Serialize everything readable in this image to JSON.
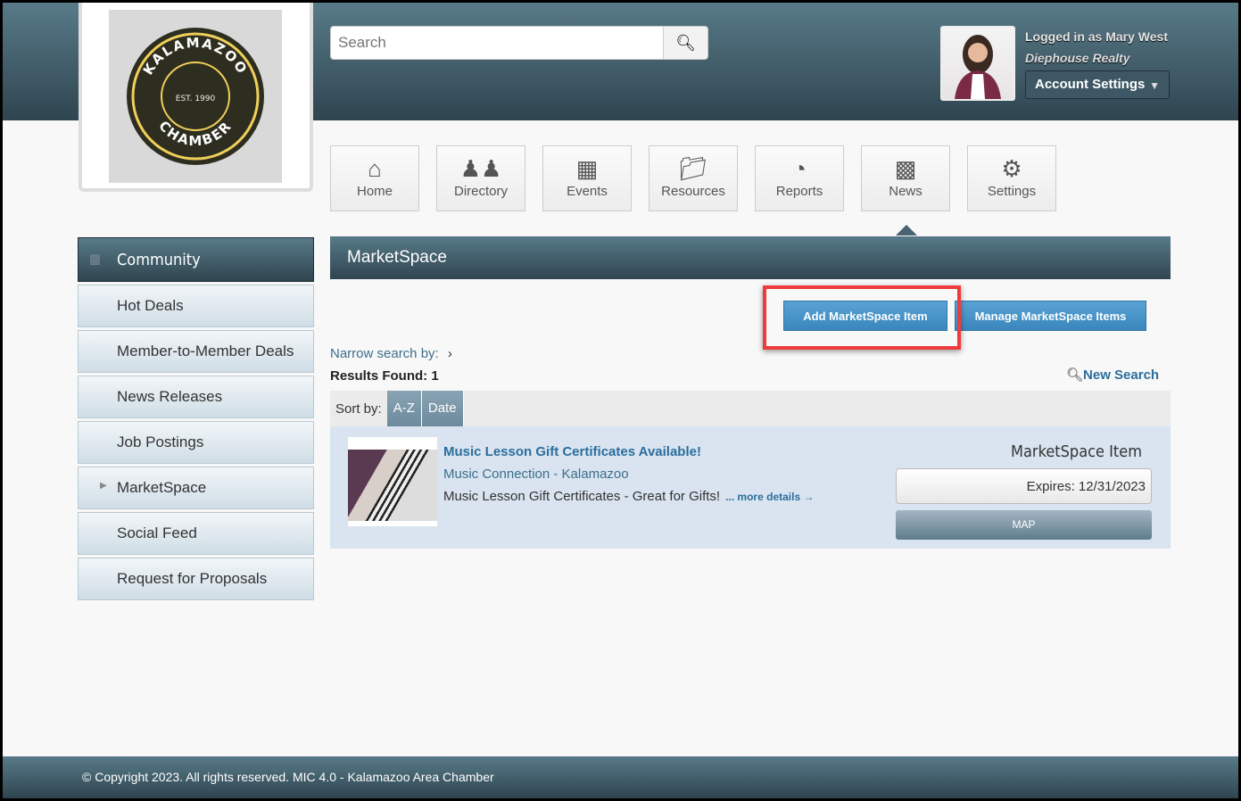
{
  "logo": {
    "text_top": "KALAMAZOO",
    "text_bottom": "CHAMBER",
    "est": "EST. 1990"
  },
  "search": {
    "placeholder": "Search",
    "icon": "search-icon"
  },
  "user": {
    "logged_in": "Logged in as Mary West",
    "company": "Diephouse Realty",
    "account_settings": "Account Settings"
  },
  "nav": [
    {
      "label": "Home",
      "icon": "home-icon"
    },
    {
      "label": "Directory",
      "icon": "people-icon"
    },
    {
      "label": "Events",
      "icon": "calendar-icon"
    },
    {
      "label": "Resources",
      "icon": "folder-icon"
    },
    {
      "label": "Reports",
      "icon": "pie-chart-icon"
    },
    {
      "label": "News",
      "icon": "buildings-icon"
    },
    {
      "label": "Settings",
      "icon": "gear-icon"
    }
  ],
  "sidebar": {
    "header": "Community",
    "items": [
      {
        "label": "Hot Deals"
      },
      {
        "label": "Member-to-Member Deals"
      },
      {
        "label": "News Releases"
      },
      {
        "label": "Job Postings"
      },
      {
        "label": "MarketSpace"
      },
      {
        "label": "Social Feed"
      },
      {
        "label": "Request for Proposals"
      }
    ]
  },
  "main": {
    "title": "MarketSpace",
    "add_button": "Add MarketSpace Item",
    "manage_button": "Manage MarketSpace Items",
    "narrow_label": "Narrow search by:",
    "results": "Results Found: 1",
    "new_search": "New Search",
    "sort_label": "Sort by:",
    "sort_options": [
      "A-Z",
      "Date"
    ],
    "result": {
      "title": "Music Lesson Gift Certificates Available!",
      "org": "Music Connection - Kalamazoo",
      "desc": "Music Lesson Gift Certificates - Great for Gifts!",
      "more": "... more details →",
      "type": "MarketSpace Item",
      "expires": "Expires: 12/31/2023",
      "map": "MAP"
    }
  },
  "footer": {
    "copyright": "© Copyright 2023. All rights reserved. MIC 4.0 - Kalamazoo Area Chamber"
  }
}
